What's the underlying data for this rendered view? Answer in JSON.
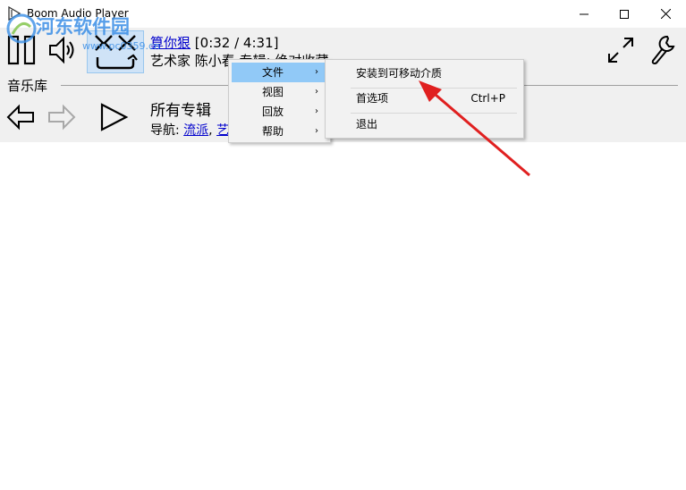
{
  "window": {
    "title": "Boom Audio Player",
    "minimize_glyph": "—",
    "maximize_glyph": "☐",
    "close_glyph": "✕"
  },
  "now_playing": {
    "title_link": "算你狠",
    "time": "[0:32 / 4:31]",
    "artist_line": "艺术家 陈小春  专辑: 绝对收藏"
  },
  "library": {
    "label": "音乐库",
    "heading": "所有专辑",
    "breadcrumb_prefix": "导航: ",
    "breadcrumb_link1": "流派",
    "breadcrumb_sep": ", ",
    "breadcrumb_link2": "艺"
  },
  "context_menu": {
    "items": [
      {
        "label": "文件",
        "has_submenu": true,
        "highlighted": true
      },
      {
        "label": "视图",
        "has_submenu": true
      },
      {
        "label": "回放",
        "has_submenu": true
      },
      {
        "label": "帮助",
        "has_submenu": true
      }
    ],
    "arrow_glyph": "›"
  },
  "file_submenu": {
    "items": [
      {
        "label": "安装到可移动介质",
        "shortcut": ""
      },
      {
        "label": "首选项",
        "shortcut": "Ctrl+P"
      },
      {
        "label": "退出",
        "shortcut": ""
      }
    ]
  },
  "watermark": {
    "text": "河东软件园",
    "url": "www.pc0359.cn"
  },
  "colors": {
    "toolbar_bg": "#f0f0f0",
    "menu_highlight": "#91c9f7",
    "link": "#0000cc",
    "annotation_arrow": "#e02020"
  }
}
